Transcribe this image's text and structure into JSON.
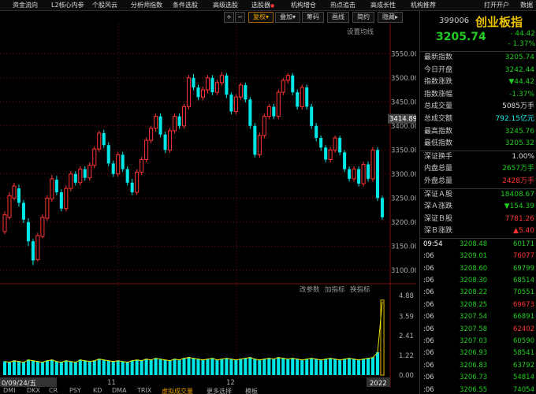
{
  "menubar": {
    "items": [
      "资金流向",
      "L2核心内参",
      "个股风云",
      "分析师指数",
      "条件选股",
      "高级选股",
      "选股器",
      "机构增仓",
      "热点追击",
      "高成长性",
      "机构推荐",
      "打开开户",
      "数据"
    ]
  },
  "toolbar": {
    "plus": "+",
    "minus": "−",
    "fuquan": "复权",
    "diejia": "叠加",
    "chouma": "筹码",
    "huaxian": "画线",
    "jianyue": "简约",
    "yincang": "隐藏"
  },
  "chart": {
    "settings_label": "设置均线",
    "price_ticks": [
      "3550.00",
      "3500.00",
      "3450.00",
      "3400.00",
      "3350.00",
      "3300.00",
      "3250.00",
      "3200.00",
      "3150.00",
      "3100.00"
    ],
    "current_price_label": "3414.89",
    "volume_ticks": [
      "4.88",
      "3.59",
      "2.41",
      "1.22",
      "0.00"
    ],
    "volume_links": [
      "改参数",
      "加指标",
      "换指标"
    ],
    "date_label": "0/09/24/五",
    "x_labels": [
      "11",
      "12",
      "2022"
    ],
    "colors": {
      "up": "#ff3333",
      "down": "#00e5e5",
      "vol": "#00e5e5",
      "grid": "#7a1010"
    }
  },
  "chart_data": {
    "type": "candlestick",
    "ylim": [
      3080,
      3580
    ],
    "candles": [
      [
        3180,
        3215,
        3175,
        3222
      ],
      [
        3210,
        3255,
        3205,
        3262
      ],
      [
        3250,
        3275,
        3245,
        3282
      ],
      [
        3270,
        3240,
        3232,
        3278
      ],
      [
        3240,
        3205,
        3198,
        3246
      ],
      [
        3200,
        3160,
        3150,
        3208
      ],
      [
        3160,
        3120,
        3110,
        3165
      ],
      [
        3122,
        3172,
        3118,
        3178
      ],
      [
        3170,
        3210,
        3166,
        3216
      ],
      [
        3208,
        3250,
        3202,
        3256
      ],
      [
        3248,
        3290,
        3242,
        3298
      ],
      [
        3288,
        3262,
        3256,
        3296
      ],
      [
        3262,
        3228,
        3222,
        3268
      ],
      [
        3228,
        3270,
        3222,
        3276
      ],
      [
        3270,
        3300,
        3264,
        3306
      ],
      [
        3300,
        3282,
        3276,
        3306
      ],
      [
        3282,
        3310,
        3276,
        3316
      ],
      [
        3310,
        3292,
        3286,
        3316
      ],
      [
        3292,
        3318,
        3286,
        3324
      ],
      [
        3318,
        3352,
        3312,
        3358
      ],
      [
        3352,
        3385,
        3346,
        3390
      ],
      [
        3385,
        3360,
        3354,
        3392
      ],
      [
        3360,
        3322,
        3316,
        3366
      ],
      [
        3322,
        3300,
        3294,
        3328
      ],
      [
        3300,
        3340,
        3294,
        3346
      ],
      [
        3340,
        3310,
        3304,
        3346
      ],
      [
        3310,
        3282,
        3276,
        3316
      ],
      [
        3282,
        3262,
        3256,
        3290
      ],
      [
        3262,
        3304,
        3256,
        3310
      ],
      [
        3304,
        3330,
        3298,
        3336
      ],
      [
        3330,
        3370,
        3324,
        3376
      ],
      [
        3370,
        3395,
        3364,
        3400
      ],
      [
        3395,
        3420,
        3388,
        3426
      ],
      [
        3420,
        3382,
        3376,
        3426
      ],
      [
        3382,
        3350,
        3344,
        3388
      ],
      [
        3350,
        3390,
        3344,
        3396
      ],
      [
        3390,
        3420,
        3384,
        3426
      ],
      [
        3420,
        3400,
        3394,
        3426
      ],
      [
        3400,
        3440,
        3394,
        3446
      ],
      [
        3440,
        3500,
        3434,
        3506
      ],
      [
        3500,
        3480,
        3474,
        3508
      ],
      [
        3480,
        3460,
        3454,
        3486
      ],
      [
        3460,
        3475,
        3454,
        3482
      ],
      [
        3475,
        3500,
        3468,
        3506
      ],
      [
        3500,
        3470,
        3464,
        3506
      ],
      [
        3470,
        3490,
        3464,
        3496
      ],
      [
        3490,
        3505,
        3484,
        3512
      ],
      [
        3505,
        3465,
        3458,
        3510
      ],
      [
        3465,
        3430,
        3424,
        3470
      ],
      [
        3430,
        3460,
        3424,
        3466
      ],
      [
        3460,
        3485,
        3454,
        3490
      ],
      [
        3485,
        3455,
        3449,
        3490
      ],
      [
        3455,
        3400,
        3394,
        3460
      ],
      [
        3400,
        3340,
        3334,
        3406
      ],
      [
        3340,
        3380,
        3334,
        3386
      ],
      [
        3380,
        3420,
        3374,
        3426
      ],
      [
        3420,
        3440,
        3414,
        3446
      ],
      [
        3440,
        3420,
        3414,
        3446
      ],
      [
        3420,
        3470,
        3414,
        3476
      ],
      [
        3470,
        3495,
        3464,
        3500
      ],
      [
        3495,
        3505,
        3488,
        3510
      ],
      [
        3505,
        3470,
        3464,
        3510
      ],
      [
        3470,
        3440,
        3434,
        3476
      ],
      [
        3440,
        3480,
        3434,
        3486
      ],
      [
        3480,
        3440,
        3434,
        3486
      ],
      [
        3440,
        3400,
        3394,
        3446
      ],
      [
        3400,
        3375,
        3368,
        3406
      ],
      [
        3375,
        3355,
        3348,
        3380
      ],
      [
        3355,
        3330,
        3324,
        3360
      ],
      [
        3330,
        3350,
        3324,
        3356
      ],
      [
        3350,
        3375,
        3344,
        3380
      ],
      [
        3375,
        3345,
        3339,
        3380
      ],
      [
        3345,
        3310,
        3304,
        3350
      ],
      [
        3310,
        3290,
        3284,
        3316
      ],
      [
        3290,
        3310,
        3284,
        3316
      ],
      [
        3310,
        3280,
        3274,
        3316
      ],
      [
        3280,
        3320,
        3274,
        3326
      ],
      [
        3320,
        3290,
        3284,
        3326
      ],
      [
        3290,
        3350,
        3284,
        3356
      ],
      [
        3350,
        3250,
        3244,
        3356
      ],
      [
        3250,
        3210,
        3205,
        3255
      ]
    ],
    "volumes": [
      0.85,
      0.8,
      0.9,
      0.85,
      0.8,
      0.95,
      0.9,
      0.85,
      0.8,
      0.9,
      0.95,
      0.85,
      0.8,
      0.9,
      0.85,
      0.8,
      0.95,
      0.9,
      0.85,
      0.9,
      1.0,
      0.95,
      0.9,
      0.85,
      0.9,
      0.85,
      0.8,
      0.9,
      0.95,
      0.9,
      1.0,
      0.95,
      1.05,
      1.0,
      0.95,
      0.9,
      1.0,
      0.95,
      1.05,
      1.1,
      1.05,
      1.0,
      0.95,
      1.0,
      1.05,
      0.95,
      1.0,
      1.05,
      1.0,
      0.95,
      1.0,
      1.05,
      1.1,
      1.0,
      0.95,
      1.0,
      1.05,
      1.0,
      1.1,
      1.05,
      1.0,
      1.05,
      1.0,
      0.95,
      1.0,
      1.05,
      1.0,
      0.95,
      1.0,
      1.05,
      1.0,
      0.95,
      1.0,
      1.05,
      1.0,
      0.95,
      1.0,
      1.05,
      1.1,
      1.4,
      4.6
    ],
    "ylabel": "",
    "xlabel": ""
  },
  "quote": {
    "code": "399006",
    "name": "创业板指",
    "price": "3205.74",
    "change": "- 44.42",
    "change_pct": "- 1.37%",
    "stats": [
      {
        "label": "最新指数",
        "value": "3205.74",
        "color": "#2c2"
      },
      {
        "label": "今日开盘",
        "value": "3242.44",
        "color": "#2c2"
      },
      {
        "label": "指数涨跌",
        "value": "▼44.42",
        "color": "#2c2"
      },
      {
        "label": "指数涨幅",
        "value": "-1.37%",
        "color": "#2c2"
      },
      {
        "label": "总成交量",
        "value": "5085万手",
        "color": "#ddd"
      },
      {
        "label": "总成交额",
        "value": "792.15亿元",
        "color": "#2ee"
      },
      {
        "label": "最高指数",
        "value": "3245.76",
        "color": "#2c2"
      },
      {
        "label": "最低指数",
        "value": "3205.32",
        "color": "#2c2"
      }
    ],
    "stats2": [
      {
        "label": "深证换手",
        "value": "1.00%",
        "color": "#ddd"
      },
      {
        "label": "内盘总量",
        "value": "2657万手",
        "color": "#2c2"
      },
      {
        "label": "外盘总量",
        "value": "2428万手",
        "color": "#f33"
      }
    ],
    "stats3": [
      {
        "label": "深证Ａ股",
        "value": "18408.67",
        "color": "#2c2"
      },
      {
        "label": "深Ａ涨跌",
        "value": "▼154.39",
        "color": "#2c2"
      },
      {
        "label": "深证Ｂ股",
        "value": "7781.26",
        "color": "#f33"
      },
      {
        "label": "深Ｂ涨跌",
        "value": "▲5.40",
        "color": "#f33"
      }
    ],
    "ticks": [
      {
        "time": "09:54",
        "price": "3208.48",
        "vol": "60171",
        "color": "#2c2"
      },
      {
        "time": ":06",
        "price": "3209.01",
        "vol": "76077",
        "color": "#f33"
      },
      {
        "time": ":06",
        "price": "3208.60",
        "vol": "69799",
        "color": "#2c2"
      },
      {
        "time": ":06",
        "price": "3208.30",
        "vol": "68514",
        "color": "#2c2"
      },
      {
        "time": ":06",
        "price": "3208.22",
        "vol": "70551",
        "color": "#2c2"
      },
      {
        "time": ":06",
        "price": "3208.25",
        "vol": "69673",
        "color": "#f33"
      },
      {
        "time": ":06",
        "price": "3207.54",
        "vol": "66891",
        "color": "#2c2"
      },
      {
        "time": ":06",
        "price": "3207.58",
        "vol": "62402",
        "color": "#f33"
      },
      {
        "time": ":06",
        "price": "3207.03",
        "vol": "60590",
        "color": "#2c2"
      },
      {
        "time": ":06",
        "price": "3206.93",
        "vol": "58541",
        "color": "#2c2"
      },
      {
        "time": ":06",
        "price": "3206.83",
        "vol": "63792",
        "color": "#2c2"
      },
      {
        "time": ":06",
        "price": "3206.73",
        "vol": "54814",
        "color": "#2c2"
      },
      {
        "time": ":06",
        "price": "3206.55",
        "vol": "74054",
        "color": "#2c2"
      }
    ]
  },
  "bottom_tabs": [
    "DMI",
    "DKX",
    "CR",
    "PSY",
    "KD",
    "DMA",
    "TRIX",
    "虚拟成交量",
    "更多选择",
    "模板"
  ]
}
